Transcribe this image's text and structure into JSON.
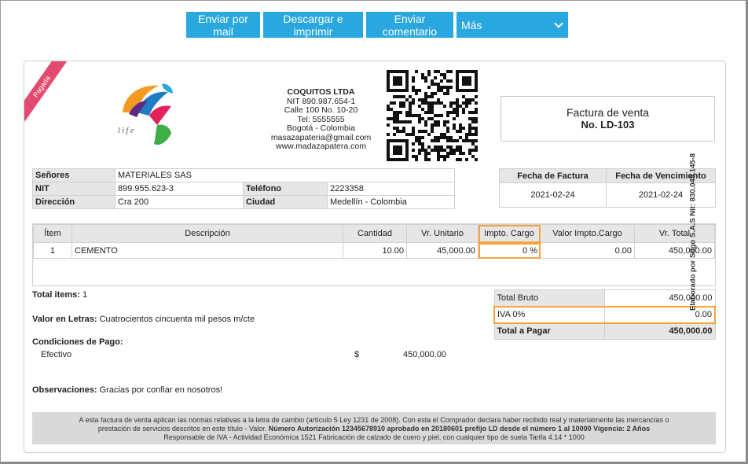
{
  "toolbar": {
    "email_label": "Enviar por mail",
    "download_label": "Descargar e imprimir",
    "comment_label": "Enviar comentario",
    "more_label": "Más"
  },
  "ribbon": "Pagada",
  "logo_text": "l i f e",
  "company": {
    "name": "COQUITOS LTDA",
    "nit": "NIT 890.987.654-1",
    "address": "Calle 100 No. 10-20",
    "tel": "Tel: 5555555",
    "city": "Bogotá - Colombia",
    "email": "masazapateria@gmail.com",
    "web": "www.madazapatera.com"
  },
  "document": {
    "title": "Factura de venta",
    "number": "No. LD-103"
  },
  "client": {
    "senores_label": "Señores",
    "senores": "MATERIALES SAS",
    "nit_label": "NIT",
    "nit": "899.955.623-3",
    "telefono_label": "Teléfono",
    "telefono": "2223358",
    "direccion_label": "Dirección",
    "direccion": "Cra 200",
    "ciudad_label": "Ciudad",
    "ciudad": "Medellín - Colombia"
  },
  "dates": {
    "fecha_factura_label": "Fecha de Factura",
    "fecha_factura": "2021-02-24",
    "fecha_venc_label": "Fecha de Vencimiento",
    "fecha_venc": "2021-02-24"
  },
  "items": {
    "headers": [
      "Ítem",
      "Descripción",
      "Cantidad",
      "Vr. Unitario",
      "Impto. Cargo",
      "Valor Impto.Cargo",
      "Vr. Total"
    ],
    "rows": [
      {
        "item": "1",
        "descripcion": "CEMENTO",
        "cantidad": "10.00",
        "unitario": "45,000.00",
        "impto": "0 %",
        "valor_impto": "0.00",
        "total": "450,000.00"
      }
    ]
  },
  "summary": {
    "total_items_label": "Total items:",
    "total_items": "1",
    "valor_letras_label": "Valor en Letras:",
    "valor_letras": "Cuatrocientos cincuenta mil pesos m/cte",
    "condiciones_label": "Condiciones de Pago:",
    "pago_metodo": "Efectivo",
    "pago_moneda": "$",
    "pago_valor": "450,000.00",
    "observaciones_label": "Observaciones:",
    "observaciones": "Gracias por confiar en nosotros!"
  },
  "totals": {
    "bruto_label": "Total Bruto",
    "bruto": "450,000.00",
    "iva_label": "IVA 0%",
    "iva": "0.00",
    "pagar_label": "Total a Pagar",
    "pagar": "450,000.00"
  },
  "footer": {
    "line1": "A esta factura de venta aplican las normas relativas a la letra de cambio (artículo 5 Ley 1231 de 2008). Con esta el Comprador declara haber recibido real y materialmente las mercancías o",
    "line2a": "prestación de servicios descritos en este título - Valor.",
    "line2b": "Número Autorización 12345678910 aprobado en 20180601 prefijo LD desde el número 1 al 10000 Vigencia: 2 Años",
    "line3": "Responsable de IVA - Actividad Económica 1521 Fabricación de calzado de cuero y piel, con cualquier tipo de suela Tarifa 4.14 * 1000"
  },
  "vertical_note": "Elaborado por Siigo S.A.S Nit: 830.048.145-8",
  "colors": {
    "button": "#29a8e0",
    "highlight": "#f3a43b",
    "ribbon": "#e34a6f",
    "header_gray": "#e6e6e6"
  }
}
